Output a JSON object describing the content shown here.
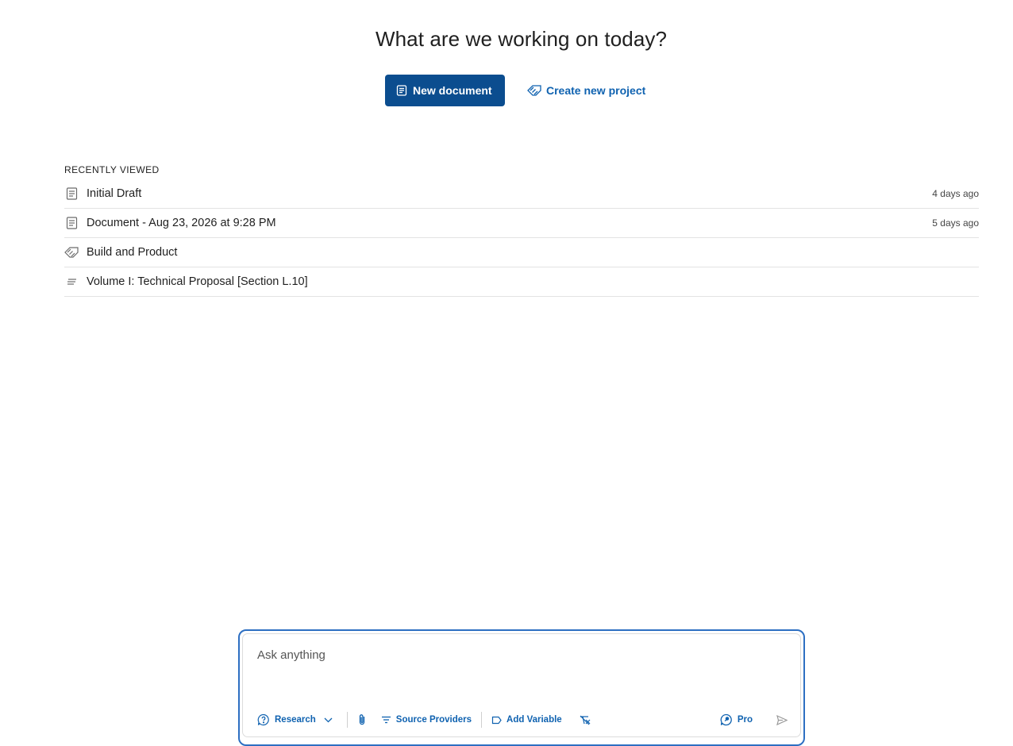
{
  "hero": {
    "title": "What are we working on today?",
    "new_document_label": "New document",
    "create_project_label": "Create new project"
  },
  "recent": {
    "heading": "RECENTLY VIEWED",
    "items": [
      {
        "title": "Initial Draft",
        "time": "4 days ago",
        "icon": "document-icon"
      },
      {
        "title": "Document - Aug 23, 2026 at 9:28 PM",
        "time": "5 days ago",
        "icon": "document-icon"
      },
      {
        "title": "Build and Product",
        "time": "",
        "icon": "project-icon"
      },
      {
        "title": "Volume I: Technical Proposal [Section L.10]",
        "time": "",
        "icon": "lines-icon"
      }
    ]
  },
  "composer": {
    "placeholder": "Ask anything",
    "mode_label": "Research",
    "source_providers_label": "Source Providers",
    "add_variable_label": "Add Variable",
    "pro_label": "Pro"
  },
  "colors": {
    "primary": "#0b4d8f",
    "link": "#0f62b0",
    "focus_border": "#2d6fc2"
  }
}
